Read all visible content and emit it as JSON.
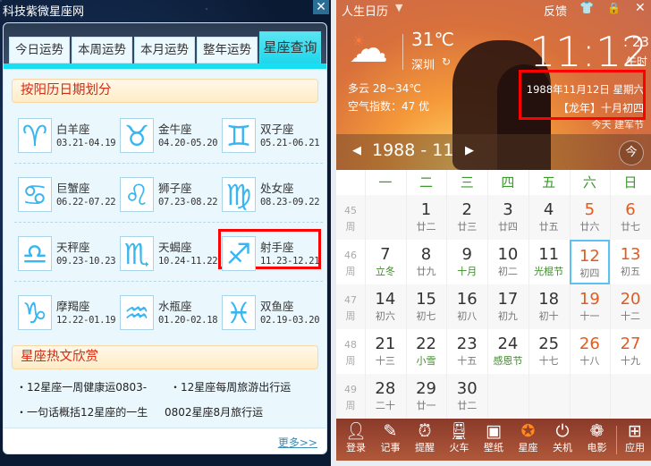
{
  "left": {
    "title": "科技紫微星座网",
    "close_icon": "close-icon",
    "tabs": [
      {
        "label": "今日运势"
      },
      {
        "label": "本周运势"
      },
      {
        "label": "本月运势"
      },
      {
        "label": "整年运势"
      },
      {
        "label": "星座查询",
        "active": true
      }
    ],
    "section1": "按阳历日期划分",
    "zodiac": [
      {
        "name": "白羊座",
        "dates": "03.21-04.19",
        "glyph": "♈"
      },
      {
        "name": "金牛座",
        "dates": "04.20-05.20",
        "glyph": "♉"
      },
      {
        "name": "双子座",
        "dates": "05.21-06.21",
        "glyph": "♊"
      },
      {
        "name": "巨蟹座",
        "dates": "06.22-07.22",
        "glyph": "♋"
      },
      {
        "name": "狮子座",
        "dates": "07.23-08.22",
        "glyph": "♌"
      },
      {
        "name": "处女座",
        "dates": "08.23-09.22",
        "glyph": "♍"
      },
      {
        "name": "天秤座",
        "dates": "09.23-10.23",
        "glyph": "♎"
      },
      {
        "name": "天蝎座",
        "dates": "10.24-11.22",
        "glyph": "♏",
        "highlighted": true
      },
      {
        "name": "射手座",
        "dates": "11.23-12.21",
        "glyph": "♐"
      },
      {
        "name": "摩羯座",
        "dates": "12.22-01.19",
        "glyph": "♑"
      },
      {
        "name": "水瓶座",
        "dates": "01.20-02.18",
        "glyph": "♒"
      },
      {
        "name": "双鱼座",
        "dates": "02.19-03.20",
        "glyph": "♓"
      }
    ],
    "section2": "星座热文欣赏",
    "articles": [
      "・12星座一周健康运0803-",
      "・12星座每周旅游出行运",
      "・一句话概括12星座的一生",
      "0802星座8月旅行运"
    ],
    "more": "更多>>",
    "zodiac_color": "#39b6f2"
  },
  "right": {
    "app_title": "人生日历",
    "feedback": "反馈",
    "icons": [
      "dropdown-icon",
      "shirt-icon",
      "lock-icon",
      "close-icon"
    ],
    "weather": {
      "icon": "partly-cloudy-icon",
      "temp": "31℃",
      "city": "深圳",
      "desc": "多云 28~34℃",
      "aqi": "空气指数：47 优"
    },
    "clock": {
      "time": "11:12",
      "seconds": ": 23",
      "period": "午时"
    },
    "date": {
      "solar": "1988年11月12日  星期六",
      "lunar": "【龙年】十月初四",
      "festival": "今天 建军节"
    },
    "month_nav": {
      "label": "1988 - 11",
      "today_label": "今"
    },
    "weekdays": [
      "一",
      "二",
      "三",
      "四",
      "五",
      "六",
      "日"
    ],
    "week_suffix": "周",
    "weeks": [
      {
        "num": "45",
        "days": [
          null,
          {
            "d": "1",
            "l": "廿二"
          },
          {
            "d": "2",
            "l": "廿三"
          },
          {
            "d": "3",
            "l": "廿四"
          },
          {
            "d": "4",
            "l": "廿五"
          },
          {
            "d": "5",
            "l": "廿六"
          },
          {
            "d": "6",
            "l": "廿七"
          }
        ]
      },
      {
        "num": "46",
        "days": [
          {
            "d": "7",
            "l": "立冬",
            "g": true
          },
          {
            "d": "8",
            "l": "廿九"
          },
          {
            "d": "9",
            "l": "十月",
            "g": true
          },
          {
            "d": "10",
            "l": "初二"
          },
          {
            "d": "11",
            "l": "光棍节",
            "g": true
          },
          {
            "d": "12",
            "l": "初四",
            "today": true
          },
          {
            "d": "13",
            "l": "初五"
          }
        ]
      },
      {
        "num": "47",
        "days": [
          {
            "d": "14",
            "l": "初六"
          },
          {
            "d": "15",
            "l": "初七"
          },
          {
            "d": "16",
            "l": "初八"
          },
          {
            "d": "17",
            "l": "初九"
          },
          {
            "d": "18",
            "l": "初十"
          },
          {
            "d": "19",
            "l": "十一"
          },
          {
            "d": "20",
            "l": "十二"
          }
        ]
      },
      {
        "num": "48",
        "days": [
          {
            "d": "21",
            "l": "十三"
          },
          {
            "d": "22",
            "l": "小雪",
            "g": true
          },
          {
            "d": "23",
            "l": "十五"
          },
          {
            "d": "24",
            "l": "感恩节",
            "g": true
          },
          {
            "d": "25",
            "l": "十七"
          },
          {
            "d": "26",
            "l": "十八"
          },
          {
            "d": "27",
            "l": "十九"
          }
        ]
      },
      {
        "num": "49",
        "days": [
          {
            "d": "28",
            "l": "二十"
          },
          {
            "d": "29",
            "l": "廿一"
          },
          {
            "d": "30",
            "l": "廿二"
          },
          null,
          null,
          null,
          null
        ]
      }
    ],
    "toolbar": [
      {
        "label": "登录",
        "icon": "user-icon",
        "glyph": "👤"
      },
      {
        "label": "记事",
        "icon": "note-icon",
        "glyph": "✎"
      },
      {
        "label": "提醒",
        "icon": "alarm-icon",
        "glyph": "⏰"
      },
      {
        "label": "火车",
        "icon": "train-icon",
        "glyph": "🚆"
      },
      {
        "label": "壁纸",
        "icon": "wallpaper-icon",
        "glyph": "▣"
      },
      {
        "label": "星座",
        "icon": "star-icon",
        "glyph": "✪",
        "active": true
      },
      {
        "label": "关机",
        "icon": "power-icon",
        "glyph": "⏻"
      },
      {
        "label": "电影",
        "icon": "film-icon",
        "glyph": "❁"
      },
      {
        "label": "应用",
        "icon": "apps-icon",
        "glyph": "⊞"
      }
    ],
    "colors": {
      "weekend": "#e35b1f",
      "festival": "#3f8a2c",
      "today_border": "#5cc2f0",
      "weekday_header": "#3a9a2a"
    }
  }
}
